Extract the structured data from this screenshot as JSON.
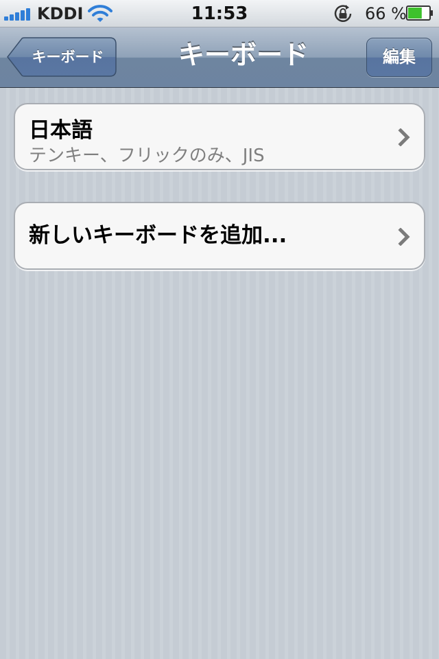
{
  "status_bar": {
    "carrier": "KDDI",
    "time": "11:53",
    "battery_percent": "66 %",
    "battery_level": 0.66,
    "signal_bars": 5
  },
  "nav": {
    "back_label": "キーボード",
    "title": "キーボード",
    "edit_label": "編集"
  },
  "keyboards": [
    {
      "title": "日本語",
      "subtitle": "テンキー、フリックのみ、JIS"
    }
  ],
  "add_keyboard": {
    "label": "新しいキーボードを追加..."
  },
  "icons": {
    "signal": "signal-strength-icon",
    "wifi": "wifi-icon",
    "orientation_lock": "orientation-lock-icon",
    "battery": "battery-icon",
    "disclosure": "chevron-right-icon"
  },
  "colors": {
    "nav_bar": "#6e85a0",
    "background": "#c5ccd4",
    "signal": "#2f7ed8",
    "battery_fill": "#3ec12c",
    "subtitle": "#7f7f7f"
  }
}
